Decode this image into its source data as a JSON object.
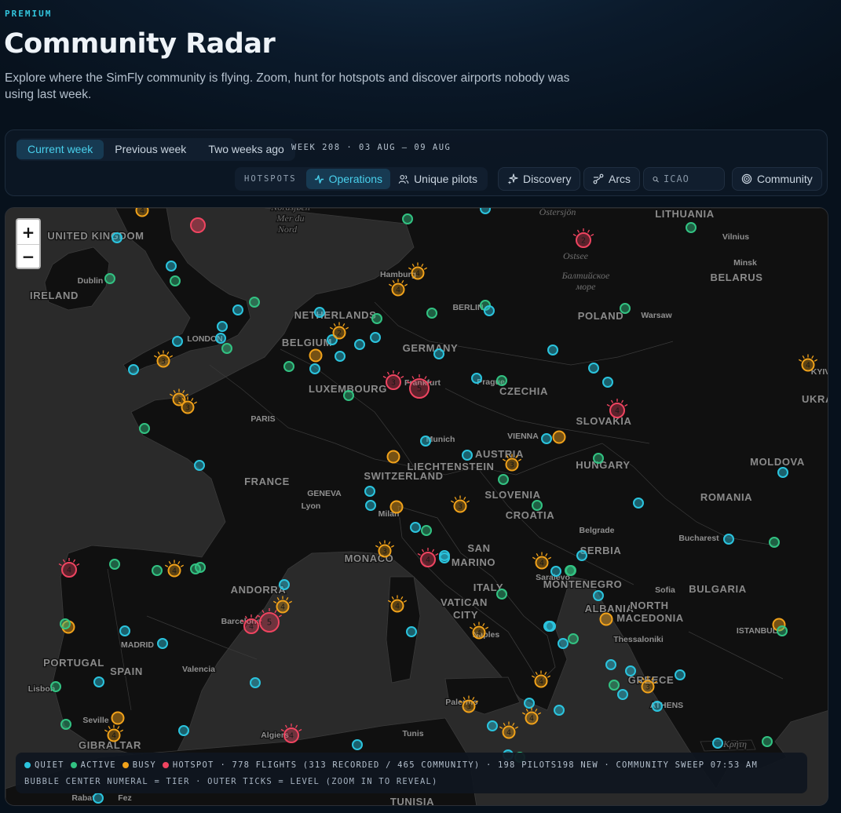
{
  "header": {
    "eyebrow": "PREMIUM",
    "title": "Community Radar",
    "subtitle": "Explore where the SimFly community is flying. Zoom, hunt for hotspots and discover airports nobody was using last week."
  },
  "controls": {
    "tabs": [
      {
        "label": "Current week",
        "active": true
      },
      {
        "label": "Previous week",
        "active": false
      },
      {
        "label": "Two weeks ago",
        "active": false
      }
    ],
    "week_label": "WEEK 208 · 03 AUG – 09 AUG",
    "hotspots_label": "HOTSPOTS",
    "operations_label": "Operations",
    "unique_pilots_label": "Unique pilots",
    "discovery_label": "Discovery",
    "arcs_label": "Arcs",
    "icao_placeholder": "ICAO",
    "community_label": "Community"
  },
  "map": {
    "zoom_in": "+",
    "zoom_out": "−",
    "labels": [
      {
        "text": "UNITED KINGDOM",
        "kind": "country"
      },
      {
        "text": "IRELAND",
        "kind": "country"
      },
      {
        "text": "Dublin",
        "kind": "city"
      },
      {
        "text": "LONDON",
        "kind": "city"
      },
      {
        "text": "NETHERLANDS",
        "kind": "country"
      },
      {
        "text": "BELGIUM",
        "kind": "country"
      },
      {
        "text": "LUXEMBOURG",
        "kind": "country"
      },
      {
        "text": "GERMANY",
        "kind": "country"
      },
      {
        "text": "Hamburg",
        "kind": "city"
      },
      {
        "text": "BERLIN",
        "kind": "city"
      },
      {
        "text": "Frankfurt",
        "kind": "city"
      },
      {
        "text": "POLAND",
        "kind": "country"
      },
      {
        "text": "Warsaw",
        "kind": "city"
      },
      {
        "text": "LITHUANIA",
        "kind": "country"
      },
      {
        "text": "BELARUS",
        "kind": "country"
      },
      {
        "text": "Minsk",
        "kind": "city"
      },
      {
        "text": "Vilnius",
        "kind": "city"
      },
      {
        "text": "Östersjön",
        "kind": "sea"
      },
      {
        "text": "Ostsee",
        "kind": "sea"
      },
      {
        "text": "Балтийское",
        "kind": "sea"
      },
      {
        "text": "море",
        "kind": "sea"
      },
      {
        "text": "Nordsjøen",
        "kind": "sea"
      },
      {
        "text": "Mer du",
        "kind": "sea"
      },
      {
        "text": "Nord",
        "kind": "sea"
      },
      {
        "text": "PARIS",
        "kind": "city"
      },
      {
        "text": "FRANCE",
        "kind": "country"
      },
      {
        "text": "CZECHIA",
        "kind": "country"
      },
      {
        "text": "Prague",
        "kind": "city"
      },
      {
        "text": "SLOVAKIA",
        "kind": "country"
      },
      {
        "text": "VIENNA",
        "kind": "city"
      },
      {
        "text": "AUSTRIA",
        "kind": "country"
      },
      {
        "text": "HUNGARY",
        "kind": "country"
      },
      {
        "text": "Munich",
        "kind": "city"
      },
      {
        "text": "LIECHTENSTEIN",
        "kind": "country"
      },
      {
        "text": "SWITZERLAND",
        "kind": "country"
      },
      {
        "text": "GENEVA",
        "kind": "city"
      },
      {
        "text": "Lyon",
        "kind": "city"
      },
      {
        "text": "Milan",
        "kind": "city"
      },
      {
        "text": "SLOVENIA",
        "kind": "country"
      },
      {
        "text": "CROATIA",
        "kind": "country"
      },
      {
        "text": "MONACO",
        "kind": "country"
      },
      {
        "text": "SAN",
        "kind": "country"
      },
      {
        "text": "MARINO",
        "kind": "country"
      },
      {
        "text": "ANDORRA",
        "kind": "country"
      },
      {
        "text": "Barcelona",
        "kind": "city"
      },
      {
        "text": "ITALY",
        "kind": "country"
      },
      {
        "text": "VATICAN",
        "kind": "country"
      },
      {
        "text": "CITY",
        "kind": "country"
      },
      {
        "text": "Naples",
        "kind": "city"
      },
      {
        "text": "Palermo",
        "kind": "city"
      },
      {
        "text": "Tunis",
        "kind": "city"
      },
      {
        "text": "Algiers",
        "kind": "city"
      },
      {
        "text": "TUNISIA",
        "kind": "country"
      },
      {
        "text": "Fez",
        "kind": "city"
      },
      {
        "text": "Rabat",
        "kind": "city"
      },
      {
        "text": "PORTUGAL",
        "kind": "country"
      },
      {
        "text": "Lisbon",
        "kind": "city"
      },
      {
        "text": "SPAIN",
        "kind": "country"
      },
      {
        "text": "MADRID",
        "kind": "city"
      },
      {
        "text": "Valencia",
        "kind": "city"
      },
      {
        "text": "Seville",
        "kind": "city"
      },
      {
        "text": "GIBRALTAR",
        "kind": "country"
      },
      {
        "text": "Sarajevo",
        "kind": "city"
      },
      {
        "text": "Belgrade",
        "kind": "city"
      },
      {
        "text": "SERBIA",
        "kind": "country"
      },
      {
        "text": "MONTENEGRO",
        "kind": "country"
      },
      {
        "text": "ALBANIA",
        "kind": "country"
      },
      {
        "text": "NORTH",
        "kind": "country"
      },
      {
        "text": "MACEDONIA",
        "kind": "country"
      },
      {
        "text": "Thessaloniki",
        "kind": "city"
      },
      {
        "text": "GREECE",
        "kind": "country"
      },
      {
        "text": "ATHENS",
        "kind": "city"
      },
      {
        "text": "Sofia",
        "kind": "city"
      },
      {
        "text": "BULGARIA",
        "kind": "country"
      },
      {
        "text": "Bucharest",
        "kind": "city"
      },
      {
        "text": "ROMANIA",
        "kind": "country"
      },
      {
        "text": "MOLDOVA",
        "kind": "country"
      },
      {
        "text": "ISTANBUL",
        "kind": "city"
      },
      {
        "text": "KYIV",
        "kind": "city"
      },
      {
        "text": "UKRA",
        "kind": "country"
      },
      {
        "text": "Κρήτη",
        "kind": "sea"
      }
    ],
    "markers": [
      {
        "status": "busy",
        "tier": "4"
      },
      {
        "status": "hotspot",
        "tier": ""
      },
      {
        "status": "quiet",
        "tier": ""
      },
      {
        "status": "active",
        "tier": ""
      },
      {
        "status": "quiet",
        "tier": ""
      },
      {
        "status": "hotspot",
        "tier": "2"
      },
      {
        "status": "active",
        "tier": ""
      },
      {
        "status": "quiet",
        "tier": ""
      },
      {
        "status": "active",
        "tier": ""
      },
      {
        "status": "active",
        "tier": ""
      },
      {
        "status": "busy",
        "tier": "4"
      },
      {
        "status": "busy",
        "tier": "4"
      },
      {
        "status": "active",
        "tier": ""
      },
      {
        "status": "quiet",
        "tier": ""
      },
      {
        "status": "quiet",
        "tier": ""
      },
      {
        "status": "active",
        "tier": ""
      },
      {
        "status": "quiet",
        "tier": ""
      },
      {
        "status": "active",
        "tier": ""
      },
      {
        "status": "active",
        "tier": ""
      },
      {
        "status": "active",
        "tier": ""
      },
      {
        "status": "quiet",
        "tier": ""
      },
      {
        "status": "quiet",
        "tier": ""
      },
      {
        "status": "quiet",
        "tier": ""
      },
      {
        "status": "quiet",
        "tier": ""
      },
      {
        "status": "active",
        "tier": ""
      },
      {
        "status": "quiet",
        "tier": ""
      },
      {
        "status": "quiet",
        "tier": ""
      },
      {
        "status": "busy",
        "tier": "3"
      },
      {
        "status": "quiet",
        "tier": ""
      },
      {
        "status": "busy",
        "tier": "2"
      },
      {
        "status": "quiet",
        "tier": ""
      },
      {
        "status": "quiet",
        "tier": ""
      },
      {
        "status": "quiet",
        "tier": ""
      },
      {
        "status": "busy",
        "tier": ""
      },
      {
        "status": "active",
        "tier": ""
      },
      {
        "status": "quiet",
        "tier": ""
      },
      {
        "status": "hotspot",
        "tier": "3"
      },
      {
        "status": "hotspot",
        "tier": "5"
      },
      {
        "status": "quiet",
        "tier": ""
      },
      {
        "status": "active",
        "tier": ""
      },
      {
        "status": "quiet",
        "tier": ""
      },
      {
        "status": "quiet",
        "tier": ""
      },
      {
        "status": "busy",
        "tier": "4"
      },
      {
        "status": "active",
        "tier": ""
      },
      {
        "status": "busy",
        "tier": "3"
      },
      {
        "status": "busy",
        "tier": "3"
      },
      {
        "status": "hotspot",
        "tier": "4"
      },
      {
        "status": "active",
        "tier": ""
      },
      {
        "status": "quiet",
        "tier": ""
      },
      {
        "status": "quiet",
        "tier": ""
      },
      {
        "status": "busy",
        "tier": ""
      },
      {
        "status": "busy",
        "tier": ""
      },
      {
        "status": "quiet",
        "tier": ""
      },
      {
        "status": "active",
        "tier": ""
      },
      {
        "status": "quiet",
        "tier": ""
      },
      {
        "status": "quiet",
        "tier": ""
      },
      {
        "status": "busy",
        "tier": "3"
      },
      {
        "status": "active",
        "tier": ""
      },
      {
        "status": "quiet",
        "tier": ""
      },
      {
        "status": "quiet",
        "tier": ""
      },
      {
        "status": "quiet",
        "tier": ""
      },
      {
        "status": "busy",
        "tier": ""
      },
      {
        "status": "busy",
        "tier": "3"
      },
      {
        "status": "active",
        "tier": ""
      },
      {
        "status": "quiet",
        "tier": ""
      },
      {
        "status": "quiet",
        "tier": ""
      },
      {
        "status": "quiet",
        "tier": ""
      },
      {
        "status": "active",
        "tier": ""
      },
      {
        "status": "active",
        "tier": ""
      },
      {
        "status": "busy",
        "tier": "3"
      },
      {
        "status": "hotspot",
        "tier": "4"
      },
      {
        "status": "quiet",
        "tier": ""
      },
      {
        "status": "hotspot",
        "tier": "4"
      },
      {
        "status": "active",
        "tier": ""
      },
      {
        "status": "active",
        "tier": ""
      },
      {
        "status": "busy",
        "tier": "4"
      },
      {
        "status": "active",
        "tier": ""
      },
      {
        "status": "active",
        "tier": ""
      },
      {
        "status": "quiet",
        "tier": ""
      },
      {
        "status": "busy",
        "tier": "4"
      },
      {
        "status": "hotspot",
        "tier": "5"
      },
      {
        "status": "hotspot",
        "tier": "4"
      },
      {
        "status": "active",
        "tier": ""
      },
      {
        "status": "quiet",
        "tier": ""
      },
      {
        "status": "active",
        "tier": ""
      },
      {
        "status": "busy",
        "tier": "4"
      },
      {
        "status": "busy",
        "tier": "4"
      },
      {
        "status": "quiet",
        "tier": ""
      },
      {
        "status": "quiet",
        "tier": ""
      },
      {
        "status": "active",
        "tier": ""
      },
      {
        "status": "quiet",
        "tier": ""
      },
      {
        "status": "busy",
        "tier": ""
      },
      {
        "status": "quiet",
        "tier": ""
      },
      {
        "status": "quiet",
        "tier": ""
      },
      {
        "status": "quiet",
        "tier": ""
      },
      {
        "status": "busy",
        "tier": "4"
      },
      {
        "status": "quiet",
        "tier": ""
      },
      {
        "status": "quiet",
        "tier": ""
      },
      {
        "status": "active",
        "tier": ""
      },
      {
        "status": "quiet",
        "tier": ""
      },
      {
        "status": "quiet",
        "tier": ""
      },
      {
        "status": "quiet",
        "tier": ""
      },
      {
        "status": "busy",
        "tier": "4"
      },
      {
        "status": "quiet",
        "tier": ""
      },
      {
        "status": "quiet",
        "tier": ""
      },
      {
        "status": "busy",
        "tier": ""
      },
      {
        "status": "active",
        "tier": ""
      },
      {
        "status": "active",
        "tier": ""
      },
      {
        "status": "busy",
        "tier": "3"
      },
      {
        "status": "busy",
        "tier": ""
      },
      {
        "status": "quiet",
        "tier": ""
      },
      {
        "status": "busy",
        "tier": "4"
      },
      {
        "status": "active",
        "tier": ""
      },
      {
        "status": "hotspot",
        "tier": "4"
      },
      {
        "status": "quiet",
        "tier": ""
      },
      {
        "status": "quiet",
        "tier": ""
      },
      {
        "status": "quiet",
        "tier": ""
      },
      {
        "status": "active",
        "tier": ""
      },
      {
        "status": "quiet",
        "tier": ""
      },
      {
        "status": "busy",
        "tier": "4"
      },
      {
        "status": "busy",
        "tier": ""
      },
      {
        "status": "active",
        "tier": ""
      },
      {
        "status": "quiet",
        "tier": ""
      },
      {
        "status": "active",
        "tier": ""
      },
      {
        "status": "quiet",
        "tier": ""
      },
      {
        "status": "busy",
        "tier": "3"
      },
      {
        "status": "quiet",
        "tier": ""
      },
      {
        "status": "quiet",
        "tier": ""
      },
      {
        "status": "quiet",
        "tier": ""
      },
      {
        "status": "busy",
        "tier": "4"
      },
      {
        "status": "active",
        "tier": ""
      },
      {
        "status": "quiet",
        "tier": ""
      },
      {
        "status": "busy",
        "tier": "3"
      },
      {
        "status": "quiet",
        "tier": ""
      },
      {
        "status": "quiet",
        "tier": ""
      },
      {
        "status": "active",
        "tier": ""
      }
    ]
  },
  "legend": {
    "quiet": "QUIET",
    "active": "ACTIVE",
    "busy": "BUSY",
    "hotspot": "HOTSPOT",
    "stats": "· 778 FLIGHTS (313 RECORDED / 465 COMMUNITY) · 198 PILOTS198 NEW  · COMMUNITY SWEEP 07:53 AM",
    "note": "BUBBLE CENTER NUMERAL = TIER · OUTER TICKS = LEVEL (ZOOM IN TO REVEAL)"
  },
  "colors": {
    "quiet": "#2bc4de",
    "active": "#32c282",
    "busy": "#f1a21a",
    "hotspot": "#ef4460",
    "accent": "#49d0ec"
  }
}
